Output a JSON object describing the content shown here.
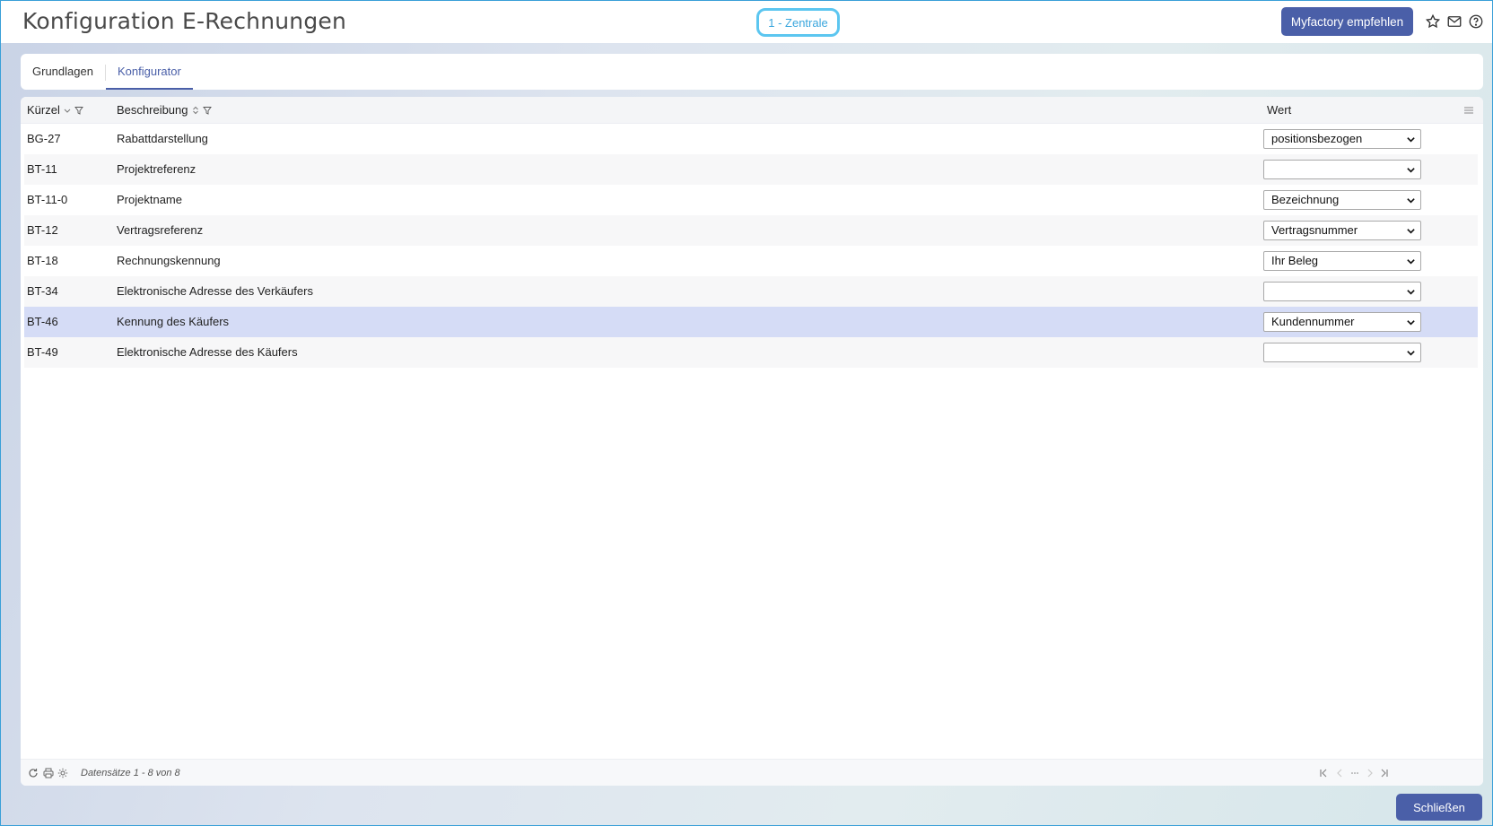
{
  "header": {
    "title": "Konfiguration E-Rechnungen",
    "tenant": "1 - Zentrale",
    "recommend_label": "Myfactory empfehlen"
  },
  "tabs": [
    {
      "label": "Grundlagen"
    },
    {
      "label": "Konfigurator"
    }
  ],
  "grid": {
    "columns": {
      "code": "Kürzel",
      "description": "Beschreibung",
      "value": "Wert"
    },
    "rows": [
      {
        "code": "BG-27",
        "description": "Rabattdarstellung",
        "value": "positionsbezogen"
      },
      {
        "code": "BT-11",
        "description": "Projektreferenz",
        "value": ""
      },
      {
        "code": "BT-11-0",
        "description": "Projektname",
        "value": "Bezeichnung"
      },
      {
        "code": "BT-12",
        "description": "Vertragsreferenz",
        "value": "Vertragsnummer"
      },
      {
        "code": "BT-18",
        "description": "Rechnungskennung",
        "value": "Ihr Beleg"
      },
      {
        "code": "BT-34",
        "description": "Elektronische Adresse des Verkäufers",
        "value": ""
      },
      {
        "code": "BT-46",
        "description": "Kennung des Käufers",
        "value": "Kundennummer"
      },
      {
        "code": "BT-49",
        "description": "Elektronische Adresse des Käufers",
        "value": ""
      }
    ],
    "records_label": "Datensätze 1 - 8 von 8"
  },
  "footer": {
    "close_label": "Schließen"
  },
  "colors": {
    "accent": "#4a5fa8",
    "tenant_border": "#5cc6f0",
    "selected_row": "#d5dcf6"
  }
}
